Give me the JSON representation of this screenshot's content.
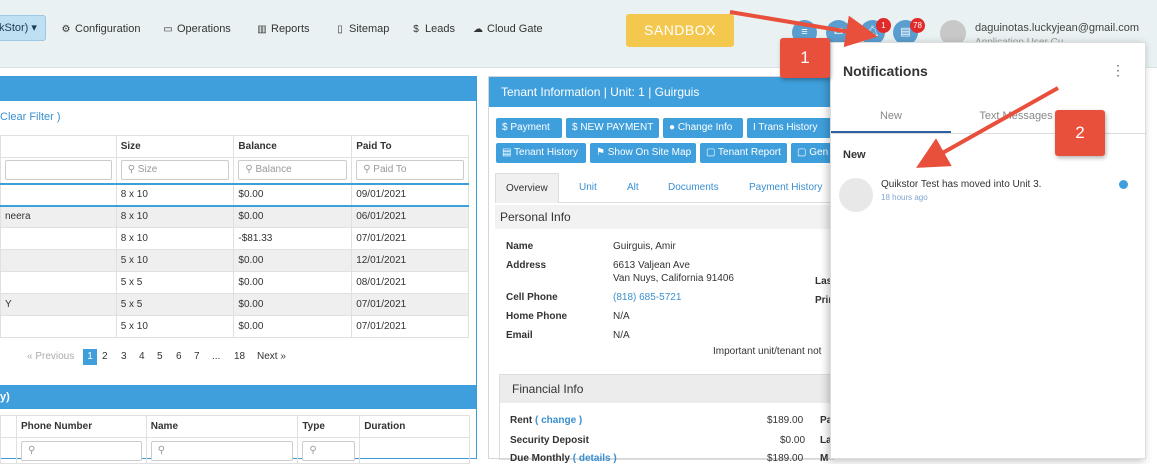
{
  "topnav": {
    "company_select": "kStor) ▾",
    "items": [
      {
        "label": "Configuration",
        "icon": "gears-icon"
      },
      {
        "label": "Operations",
        "icon": "monitor-icon"
      },
      {
        "label": "Reports",
        "icon": "bar-chart-icon"
      },
      {
        "label": "Sitemap",
        "icon": "map-icon"
      },
      {
        "label": "Leads",
        "icon": "dollar-icon"
      },
      {
        "label": "Cloud Gate",
        "icon": "cloud-gate-icon"
      }
    ],
    "sandbox_label": "SANDBOX",
    "notification_count": "1",
    "message_count": "78",
    "user_email": "daguinotas.luckyjean@gmail.com",
    "user_sub": "Application User Cu..."
  },
  "units_panel": {
    "clear_filter": "Clear Filter )",
    "columns": [
      "",
      "Size",
      "Balance",
      "Paid To"
    ],
    "filter_placeholders": [
      "",
      "Size",
      "Balance",
      "Paid To"
    ],
    "rows": [
      {
        "name": "",
        "size": "8 x 10",
        "balance": "$0.00",
        "paid_to": "09/01/2021"
      },
      {
        "name": "neera",
        "size": "8 x 10",
        "balance": "$0.00",
        "paid_to": "06/01/2021"
      },
      {
        "name": "",
        "size": "8 x 10",
        "balance": "-$81.33",
        "paid_to": "07/01/2021"
      },
      {
        "name": "",
        "size": "5 x 10",
        "balance": "$0.00",
        "paid_to": "12/01/2021"
      },
      {
        "name": "",
        "size": "5 x 5",
        "balance": "$0.00",
        "paid_to": "08/01/2021"
      },
      {
        "name": "Y",
        "size": "5 x 5",
        "balance": "$0.00",
        "paid_to": "07/01/2021"
      },
      {
        "name": "",
        "size": "5 x 10",
        "balance": "$0.00",
        "paid_to": "07/01/2021"
      }
    ],
    "pager": {
      "prev": "« Previous",
      "pages": [
        "1",
        "2",
        "3",
        "4",
        "5",
        "6",
        "7",
        "...",
        "18"
      ],
      "next": "Next »"
    }
  },
  "leads_panel": {
    "title": "y)",
    "columns": [
      "Phone Number",
      "Name",
      "Type",
      "Duration"
    ]
  },
  "tenant": {
    "title": "Tenant Information | Unit: 1 | Guirguis",
    "buttons_row1": [
      "$ Payment",
      "$ NEW PAYMENT",
      "Change Info",
      "Trans History"
    ],
    "buttons_row2": [
      "Tenant History",
      "Show On Site Map",
      "Tenant Report",
      "Gen"
    ],
    "tabs": [
      "Overview",
      "Unit",
      "Alt",
      "Documents",
      "Payment History"
    ],
    "personal_info": "Personal Info",
    "fields": [
      {
        "label": "Name",
        "value": "Guirguis, Amir"
      },
      {
        "label": "Address",
        "value": "6613 Valjean Ave"
      },
      {
        "label": "",
        "value": "Van Nuys, California 91406"
      },
      {
        "label": "Cell Phone",
        "value": "(818) 685-5721"
      },
      {
        "label": "Home Phone",
        "value": "N/A"
      },
      {
        "label": "Email",
        "value": "N/A"
      }
    ],
    "side_labels": [
      "Las",
      "Prin"
    ],
    "note": "Important unit/tenant not",
    "financial_info": "Financial Info",
    "financial": [
      {
        "label": "Rent",
        "link": "( change )",
        "value": "$189.00",
        "side": "Pa"
      },
      {
        "label": "Security Deposit",
        "link": "",
        "value": "$0.00",
        "side": "La"
      },
      {
        "label": "Due Monthly",
        "link": "( details )",
        "value": "$189.00",
        "side": "M"
      }
    ]
  },
  "notifications": {
    "title": "Notifications",
    "tabs": [
      "New",
      "Text Messages"
    ],
    "section": "New",
    "items": [
      {
        "message": "Quikstor Test has moved into Unit 3.",
        "time": "18 hours ago"
      }
    ]
  },
  "callouts": [
    "1",
    "2"
  ]
}
